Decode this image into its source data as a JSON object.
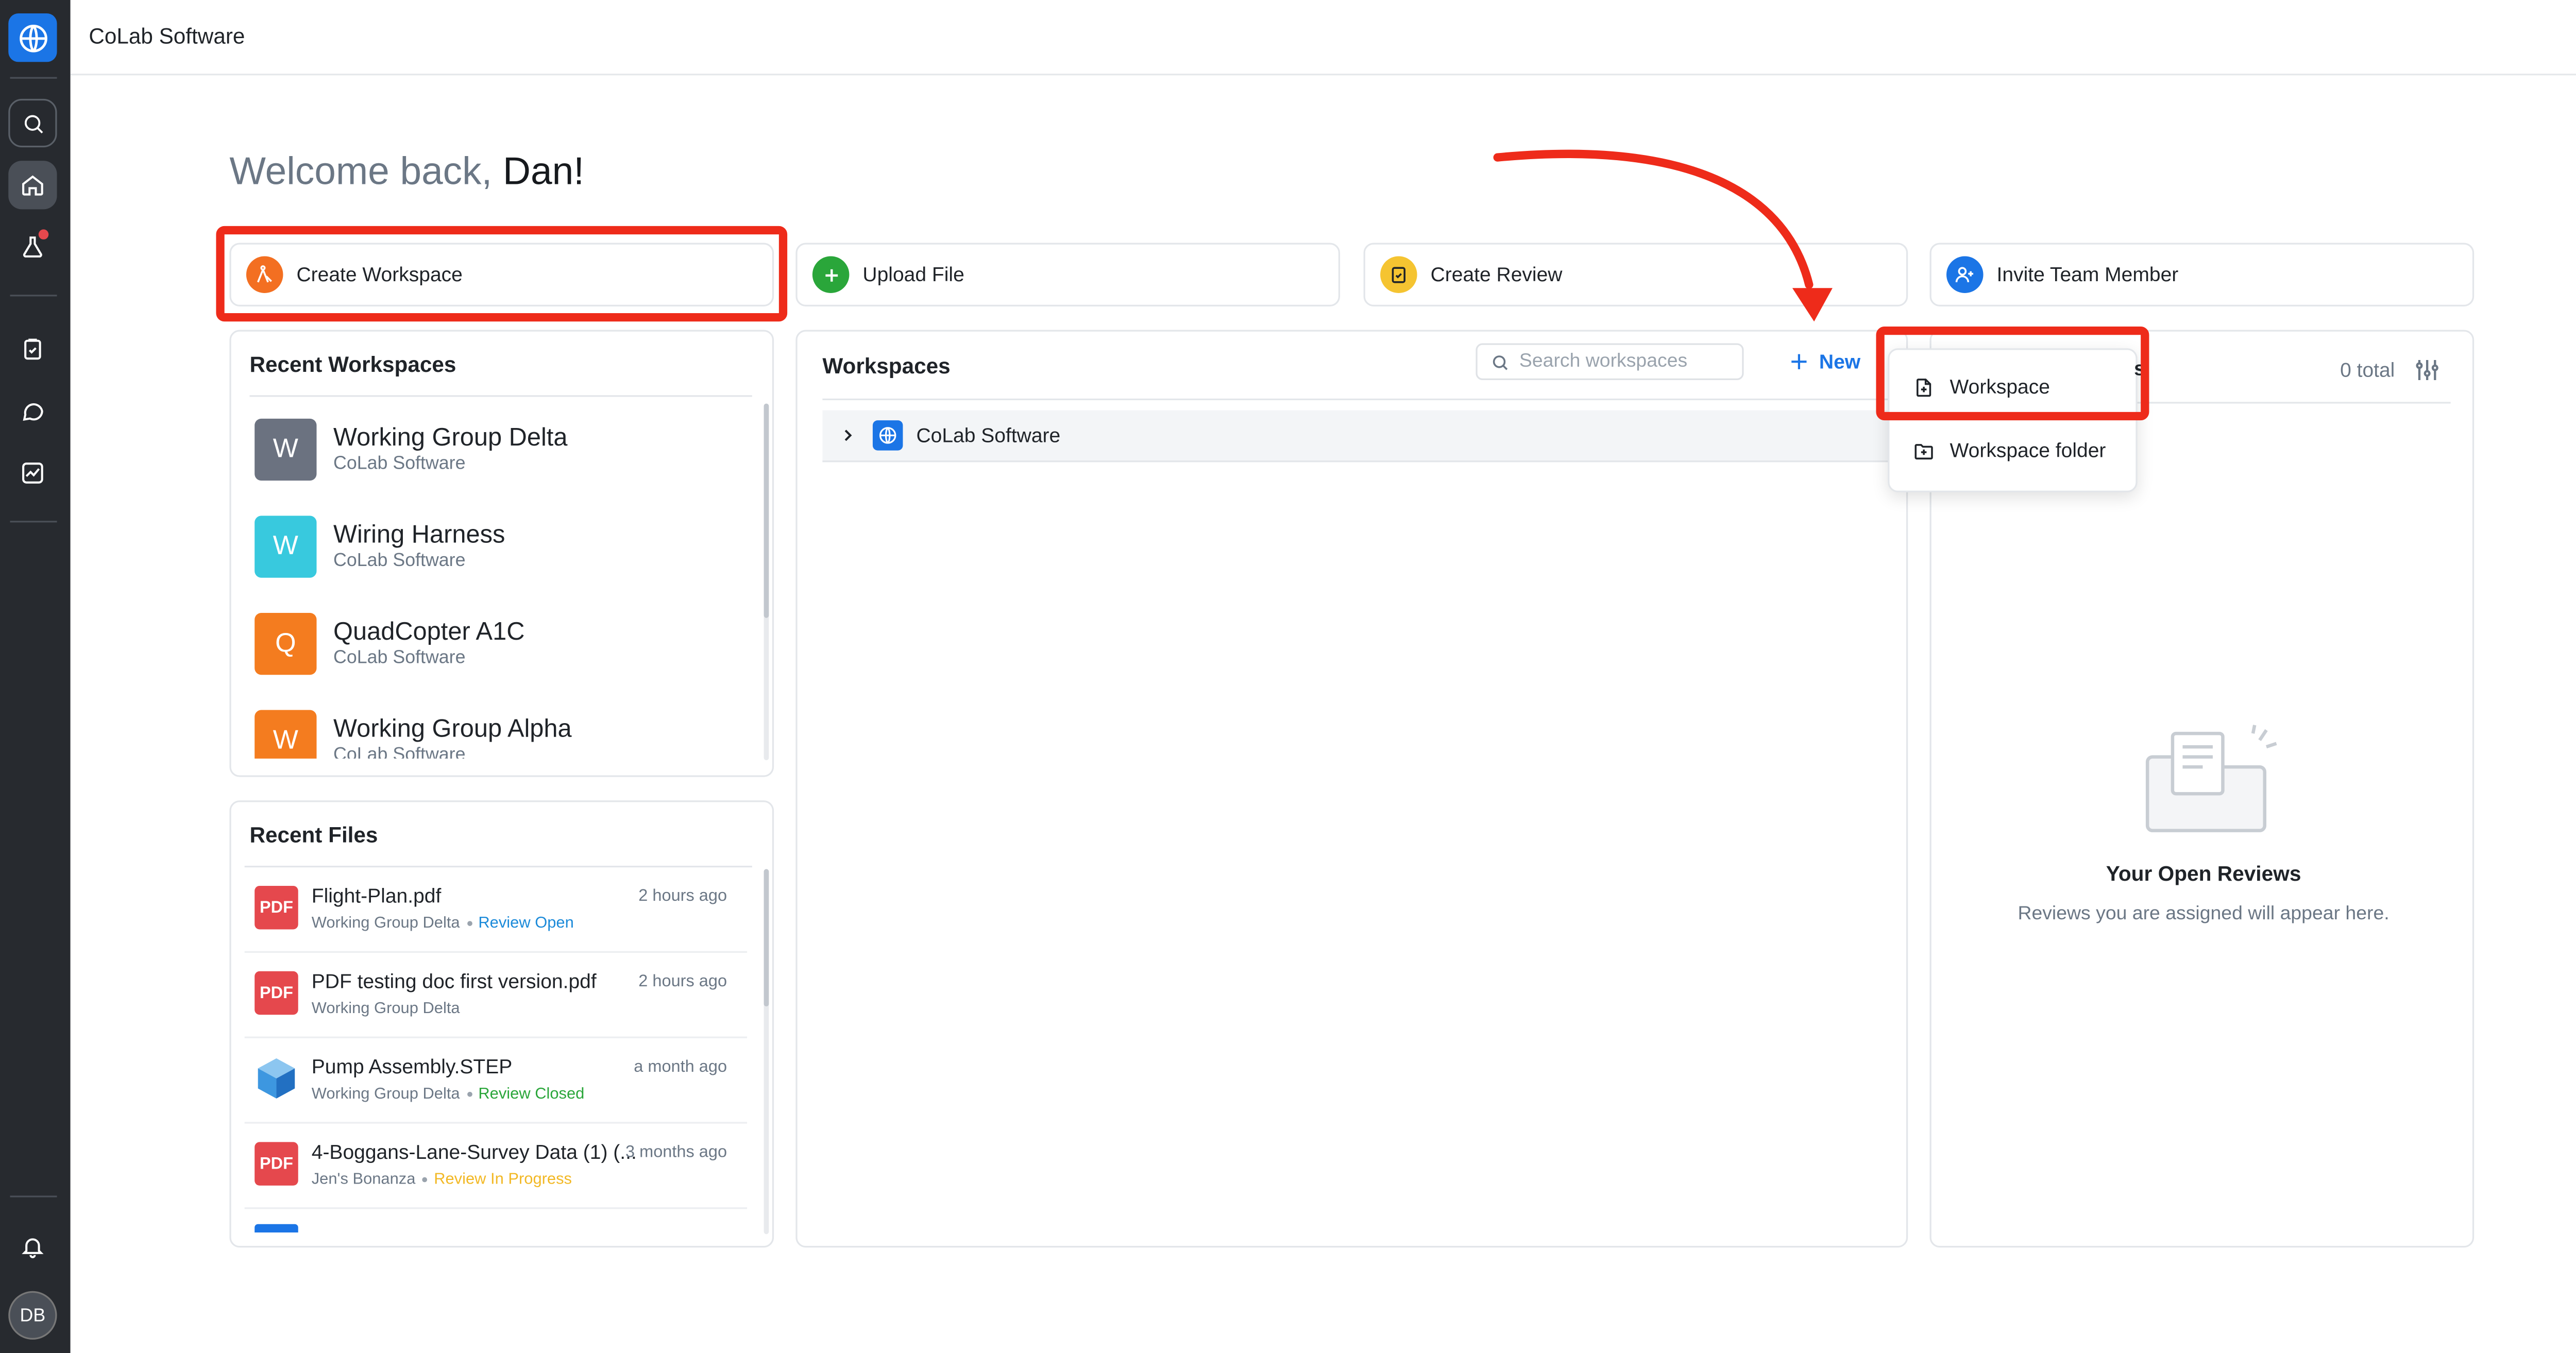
{
  "app": {
    "org_name": "CoLab Software",
    "logo_icon": "globe-icon",
    "accent": "#1b75e6"
  },
  "rail": {
    "avatar_initials": "DB"
  },
  "welcome": {
    "prefix": "Welcome back,",
    "name": "Dan!"
  },
  "actions": [
    {
      "label": "Create Workspace",
      "icon": "compass-icon",
      "color": "#f36f21"
    },
    {
      "label": "Upload File",
      "icon": "plus-icon",
      "color": "#2aa63a"
    },
    {
      "label": "Create Review",
      "icon": "clipboard-check-icon",
      "color": "#f5c431"
    },
    {
      "label": "Invite Team Member",
      "icon": "user-plus-icon",
      "color": "#1b75e6"
    }
  ],
  "recent_workspaces": {
    "title": "Recent Workspaces",
    "items": [
      {
        "letter": "W",
        "name": "Working Group Delta",
        "org": "CoLab Software",
        "color": "#6b7280"
      },
      {
        "letter": "W",
        "name": "Wiring Harness",
        "org": "CoLab Software",
        "color": "#38c9de"
      },
      {
        "letter": "Q",
        "name": "QuadCopter A1C",
        "org": "CoLab Software",
        "color": "#f47c1f"
      },
      {
        "letter": "W",
        "name": "Working Group Alpha",
        "org": "CoLab Software",
        "color": "#f47c1f"
      }
    ]
  },
  "recent_files": {
    "title": "Recent Files",
    "items": [
      {
        "name": "Flight-Plan.pdf",
        "time": "2 hours ago",
        "workspace": "Working Group Delta",
        "status": "Review Open",
        "status_color": "#1b8ad9",
        "type": "PDF"
      },
      {
        "name": "PDF testing doc first version.pdf",
        "time": "2 hours ago",
        "workspace": "Working Group Delta",
        "status": "",
        "type": "PDF"
      },
      {
        "name": "Pump Assembly.STEP",
        "time": "a month ago",
        "workspace": "Working Group Delta",
        "status": "Review Closed",
        "status_color": "#2aa63a",
        "type": "STEP"
      },
      {
        "name": "4-Boggans-Lane-Survey Data (1) (...",
        "time": "3 months ago",
        "workspace": "Jen's Bonanza",
        "status": "Review In Progress",
        "status_color": "#f2b824",
        "type": "PDF"
      }
    ]
  },
  "workspaces_panel": {
    "title": "Workspaces",
    "search_placeholder": "Search workspaces",
    "new_label": "New",
    "tree": [
      {
        "name": "CoLab Software"
      }
    ]
  },
  "new_menu": {
    "items": [
      {
        "label": "Workspace",
        "icon": "file-plus-icon"
      },
      {
        "label": "Workspace folder",
        "icon": "folder-plus-icon"
      }
    ]
  },
  "reviews_panel": {
    "total": "0 total",
    "empty_title": "Your Open Reviews",
    "empty_text": "Reviews you are assigned will appear here."
  },
  "annotation": {
    "color": "#ee2b1a"
  }
}
